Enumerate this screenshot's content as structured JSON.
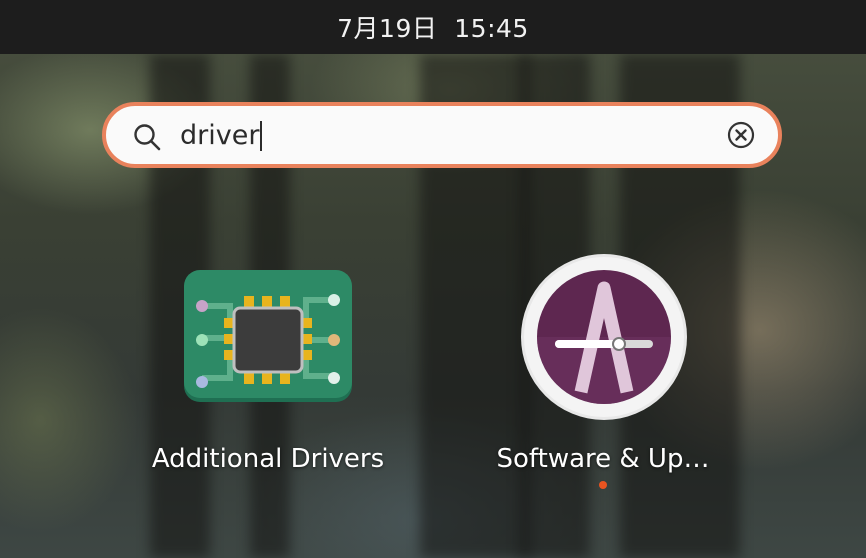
{
  "topbar": {
    "clock": "7月19日  15:45"
  },
  "search": {
    "value": "driver",
    "icon": "search-icon",
    "clear_icon": "clear-icon"
  },
  "apps": [
    {
      "label": "Additional Drivers",
      "icon": "additional-drivers-icon",
      "running": false
    },
    {
      "label": "Software & Up…",
      "icon": "software-updates-icon",
      "running": true
    }
  ],
  "colors": {
    "search_border": "#e9825c",
    "running_indicator": "#e95420",
    "topbar_bg": "#1d1d1d"
  }
}
